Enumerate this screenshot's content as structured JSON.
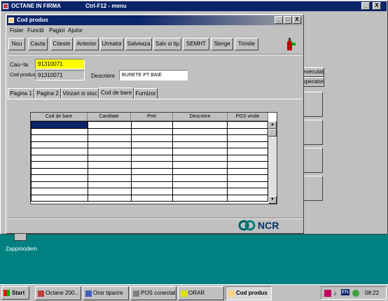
{
  "colors": {
    "desktop": "#008080",
    "title_active": "#0a246a",
    "title_inactive": "#808080",
    "highlight": "#ffff00"
  },
  "bg_window": {
    "title": "OCTANE IN FIRMA",
    "shortcut": "Ctrl-F12 - menu",
    "buttons": [
      "executat",
      "operatori"
    ]
  },
  "window": {
    "title": "Cod produs",
    "menu": [
      "Fisier",
      "Functii",
      "Pagini",
      "Ajutor"
    ],
    "toolbar": [
      "Nou",
      "Cauta",
      "Citeste",
      "Anterior",
      "Urmator",
      "Salveaza",
      "Salv si tip",
      "SEMHT",
      "Sterge",
      "Trimite"
    ],
    "cauta_label": "Cau~ta",
    "cauta_value": "91310071",
    "cod_label": "Cod produs",
    "cod_value": "91310071",
    "descriere_label": "Descriere",
    "descriere_value": "BURETE PT BAIE",
    "tabs": [
      "Pagina 1",
      "Pagina 2",
      "Vinzari si stoc",
      "Cod de bare",
      "Furnizor"
    ],
    "grid_headers": [
      "Cod de bare",
      "Cantitate",
      "Pret",
      "Descriere",
      "POS vinde"
    ],
    "logo": "NCR",
    "close_glyph": "X"
  },
  "desktop_icon": {
    "label": "Zappmodem"
  },
  "taskbar": {
    "start": "Start",
    "tasks": [
      "Octane 200...",
      "Orar tiparire",
      "POS conectat",
      "ORAR",
      "Cod produs"
    ],
    "tray": [
      "EN"
    ],
    "clock": "08:22"
  }
}
